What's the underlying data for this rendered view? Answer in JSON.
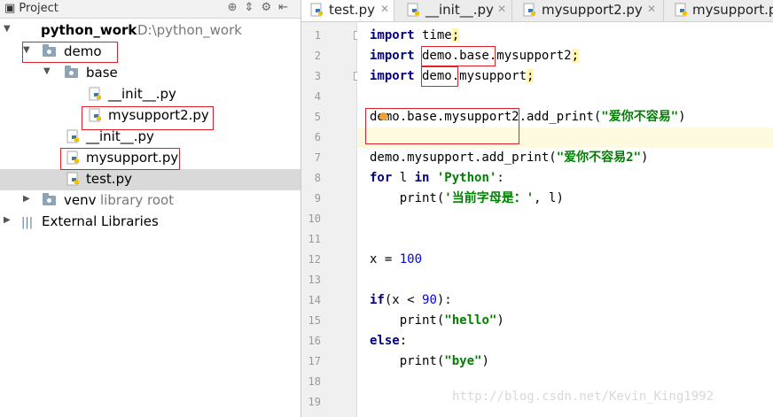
{
  "project_panel": {
    "title": "Project",
    "tree": [
      {
        "label": "python_work",
        "path": "D:\\python_work"
      },
      {
        "label": "demo"
      },
      {
        "label": "base"
      },
      {
        "label": "__init__.py"
      },
      {
        "label": "mysupport2.py"
      },
      {
        "label": "__init__.py"
      },
      {
        "label": "mysupport.py"
      },
      {
        "label": "test.py"
      },
      {
        "label": "venv",
        "sub": "library root"
      },
      {
        "label": "External Libraries"
      }
    ]
  },
  "tabs": [
    {
      "label": "test.py"
    },
    {
      "label": "__init__.py"
    },
    {
      "label": "mysupport2.py"
    },
    {
      "label": "mysupport.p"
    }
  ],
  "editor": {
    "lines": [
      "1",
      "2",
      "3",
      "4",
      "5",
      "6",
      "7",
      "8",
      "9",
      "10",
      "11",
      "12",
      "13",
      "14",
      "15",
      "16",
      "17",
      "18",
      "19"
    ],
    "code": {
      "l1_kw": "import",
      "l1_rest": " time",
      "l2_kw": "import",
      "l2_rest": " demo.base.mysupport2",
      "l3_kw": "import",
      "l3_rest": " demo.mysupport",
      "l5_a": "demo.base.mysupport2.add_print(",
      "l5_s": "\"爱你不容易\"",
      "l5_b": ")",
      "l7_a": "demo.mysupport.add_print(",
      "l7_s": "\"爱你不容易2\"",
      "l7_b": ")",
      "l8_kw1": "for",
      "l8_v": " l ",
      "l8_kw2": "in",
      "l8_s": " 'Python'",
      "l8_c": ":",
      "l9_a": "    print(",
      "l9_s": "'当前字母是：'",
      "l9_b": ", l)",
      "l12_a": "x = ",
      "l12_n": "100",
      "l14_kw": "if",
      "l14_a": "(x < ",
      "l14_n": "90",
      "l14_b": "):",
      "l15_a": "    print(",
      "l15_s": "\"hello\"",
      "l15_b": ")",
      "l16_kw": "else",
      "l16_b": ":",
      "l17_a": "    print(",
      "l17_s": "\"bye\"",
      "l17_b": ")"
    }
  },
  "watermark": "http://blog.csdn.net/Kevin_King1992"
}
